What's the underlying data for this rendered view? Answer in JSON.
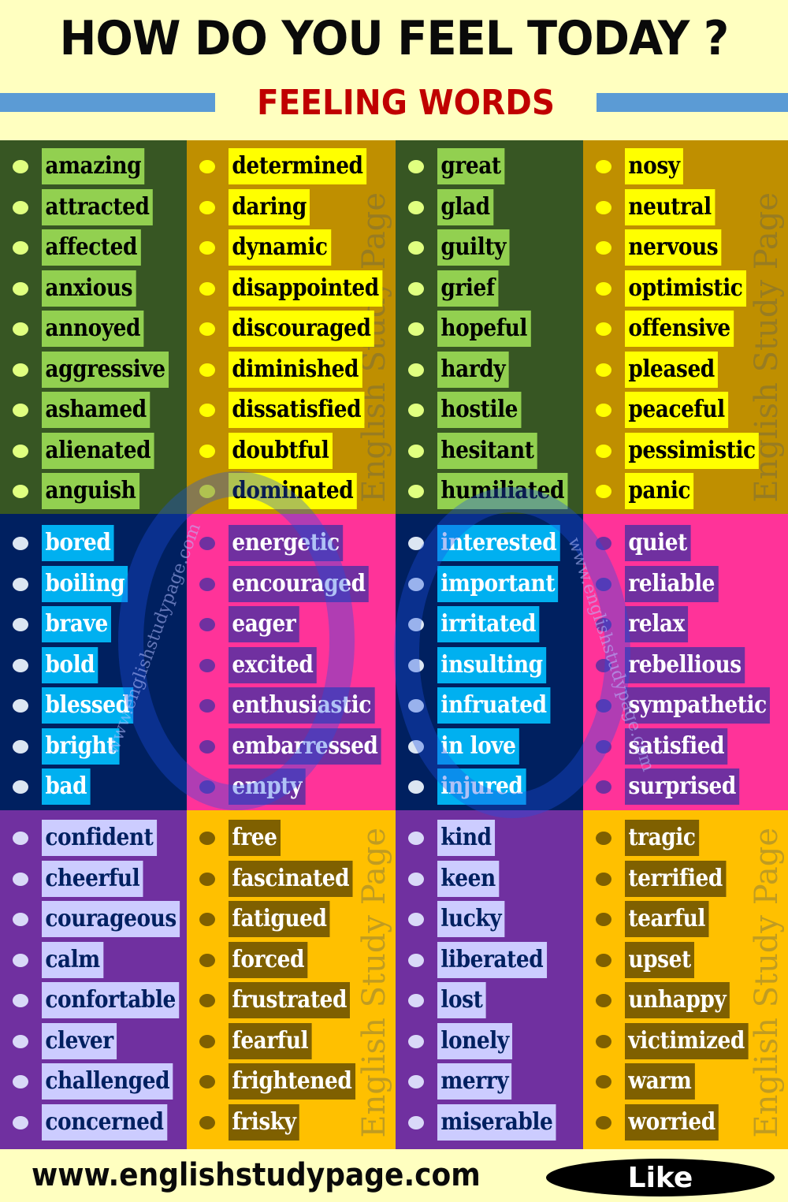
{
  "header": {
    "title": "HOW DO YOU FEEL TODAY ?",
    "subtitle": "FEELING WORDS"
  },
  "watermarks": {
    "vertical": "English Study Page",
    "circle_left": "www.englishstudypage.com",
    "circle_right": "www.englishstudypage.com"
  },
  "colors": {
    "header_bg": "#ffffc0",
    "title": "#0a0a0a",
    "subtitle": "#c00000",
    "rule": "#5b9bd5"
  },
  "groups": [
    {
      "row": 1,
      "col": 1,
      "theme": "dark-green",
      "words": [
        "amazing",
        "attracted",
        "affected",
        "anxious",
        "annoyed",
        "aggressive",
        "ashamed",
        "alienated",
        "anguish"
      ]
    },
    {
      "row": 1,
      "col": 2,
      "theme": "gold",
      "words": [
        "determined",
        "daring",
        "dynamic",
        "disappointed",
        "discouraged",
        "diminished",
        "dissatisfied",
        "doubtful",
        "dominated"
      ]
    },
    {
      "row": 1,
      "col": 3,
      "theme": "dark-green",
      "words": [
        "great",
        "glad",
        "guilty",
        "grief",
        "hopeful",
        "hardy",
        "hostile",
        "hesitant",
        "humiliated"
      ]
    },
    {
      "row": 1,
      "col": 4,
      "theme": "gold",
      "words": [
        "nosy",
        "neutral",
        "nervous",
        "optimistic",
        "offensive",
        "pleased",
        "peaceful",
        "pessimistic",
        "panic"
      ]
    },
    {
      "row": 2,
      "col": 1,
      "theme": "navy",
      "words": [
        "bored",
        "boiling",
        "brave",
        "bold",
        "blessed",
        "bright",
        "bad"
      ]
    },
    {
      "row": 2,
      "col": 2,
      "theme": "pink",
      "words": [
        "energetic",
        "encouraged",
        "eager",
        "excited",
        "enthusiastic",
        "embarressed",
        "empty"
      ]
    },
    {
      "row": 2,
      "col": 3,
      "theme": "navy",
      "words": [
        "interested",
        "important",
        "irritated",
        "insulting",
        "infruated",
        "in love",
        "injured"
      ]
    },
    {
      "row": 2,
      "col": 4,
      "theme": "pink",
      "words": [
        "quiet",
        "reliable",
        "relax",
        "rebellious",
        "sympathetic",
        "satisfied",
        "surprised"
      ]
    },
    {
      "row": 3,
      "col": 1,
      "theme": "purple",
      "words": [
        "confident",
        "cheerful",
        "courageous",
        "calm",
        "confortable",
        "clever",
        "challenged",
        "concerned"
      ]
    },
    {
      "row": 3,
      "col": 2,
      "theme": "amber",
      "words": [
        "free",
        "fascinated",
        "fatigued",
        "forced",
        "frustrated",
        "fearful",
        "frightened",
        "frisky"
      ]
    },
    {
      "row": 3,
      "col": 3,
      "theme": "purple",
      "words": [
        "kind",
        "keen",
        "lucky",
        "liberated",
        "lost",
        "lonely",
        "merry",
        "miserable"
      ]
    },
    {
      "row": 3,
      "col": 4,
      "theme": "amber",
      "words": [
        "tragic",
        "terrified",
        "tearful",
        "upset",
        "unhappy",
        "victimized",
        "warm",
        "worried"
      ]
    }
  ],
  "footer": {
    "website": "www.englishstudypage.com",
    "like_label": "Like"
  }
}
